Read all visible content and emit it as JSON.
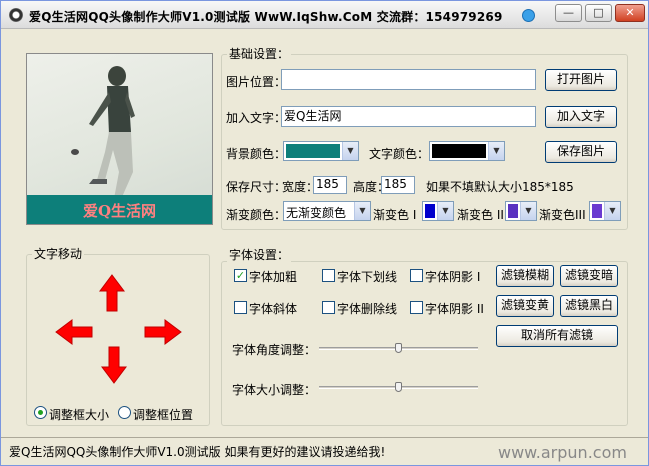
{
  "window": {
    "title": "爱Q生活网QQ头像制作大师V1.0测试版 WwW.IqShw.CoM  交流群：154979269",
    "minimize_label": "—",
    "maximize_label": "□",
    "close_label": "✕"
  },
  "preview": {
    "overlay_text": "爱Q生活网",
    "band_color": "#0d7f7a",
    "text_color": "#ff8080"
  },
  "basic": {
    "group_label": "基础设置：",
    "image_path_label": "图片位置：",
    "image_path_value": "",
    "open_image_label": "打开图片",
    "add_text_label": "加入文字：",
    "add_text_value": "爱Q生活网",
    "add_text_button": "加入文字",
    "bg_color_label": "背景颜色：",
    "bg_color_value": "#0d7f7a",
    "text_color_label": "文字颜色：",
    "text_color_value": "#000000",
    "save_image_label": "保存图片",
    "save_size_label": "保存尺寸：",
    "width_label": "宽度：",
    "width_value": "185",
    "height_label": "高度：",
    "height_value": "185",
    "default_size_note": "如果不填默认大小185*185",
    "gradient_color_label": "渐变颜色：",
    "gradient_select_value": "无渐变颜色",
    "gradient1_label": "渐变色 I",
    "gradient1_color": "#0000cc",
    "gradient2_label": "渐变色 II",
    "gradient2_color": "#5a32c0",
    "gradient3_label": "渐变色III",
    "gradient3_color": "#6a3ad0"
  },
  "move": {
    "group_label": "文字移动",
    "arrow_color": "#ff0000",
    "radio_resize_label": "调整框大小",
    "radio_resize_checked": true,
    "radio_position_label": "调整框位置",
    "radio_position_checked": false
  },
  "font": {
    "group_label": "字体设置：",
    "bold_label": "字体加粗",
    "bold_checked": true,
    "underline_label": "字体下划线",
    "underline_checked": false,
    "shadow1_label": "字体阴影 I",
    "shadow1_checked": false,
    "italic_label": "字体斜体",
    "italic_checked": false,
    "strike_label": "字体删除线",
    "strike_checked": false,
    "shadow2_label": "字体阴影 II",
    "shadow2_checked": false,
    "filter_blur": "滤镜模糊",
    "filter_darken": "滤镜变暗",
    "filter_sharpen": "滤镜变黄",
    "filter_bw": "滤镜黑白",
    "cancel_filters": "取消所有滤镜",
    "angle_label": "字体角度调整：",
    "angle_value": 0.5,
    "size_label": "字体大小调整：",
    "size_value": 0.5
  },
  "status": {
    "text": "爱Q生活网QQ头像制作大师V1.0测试版   如果有更好的建议请投递给我!",
    "watermark": "www.arpun.com"
  }
}
